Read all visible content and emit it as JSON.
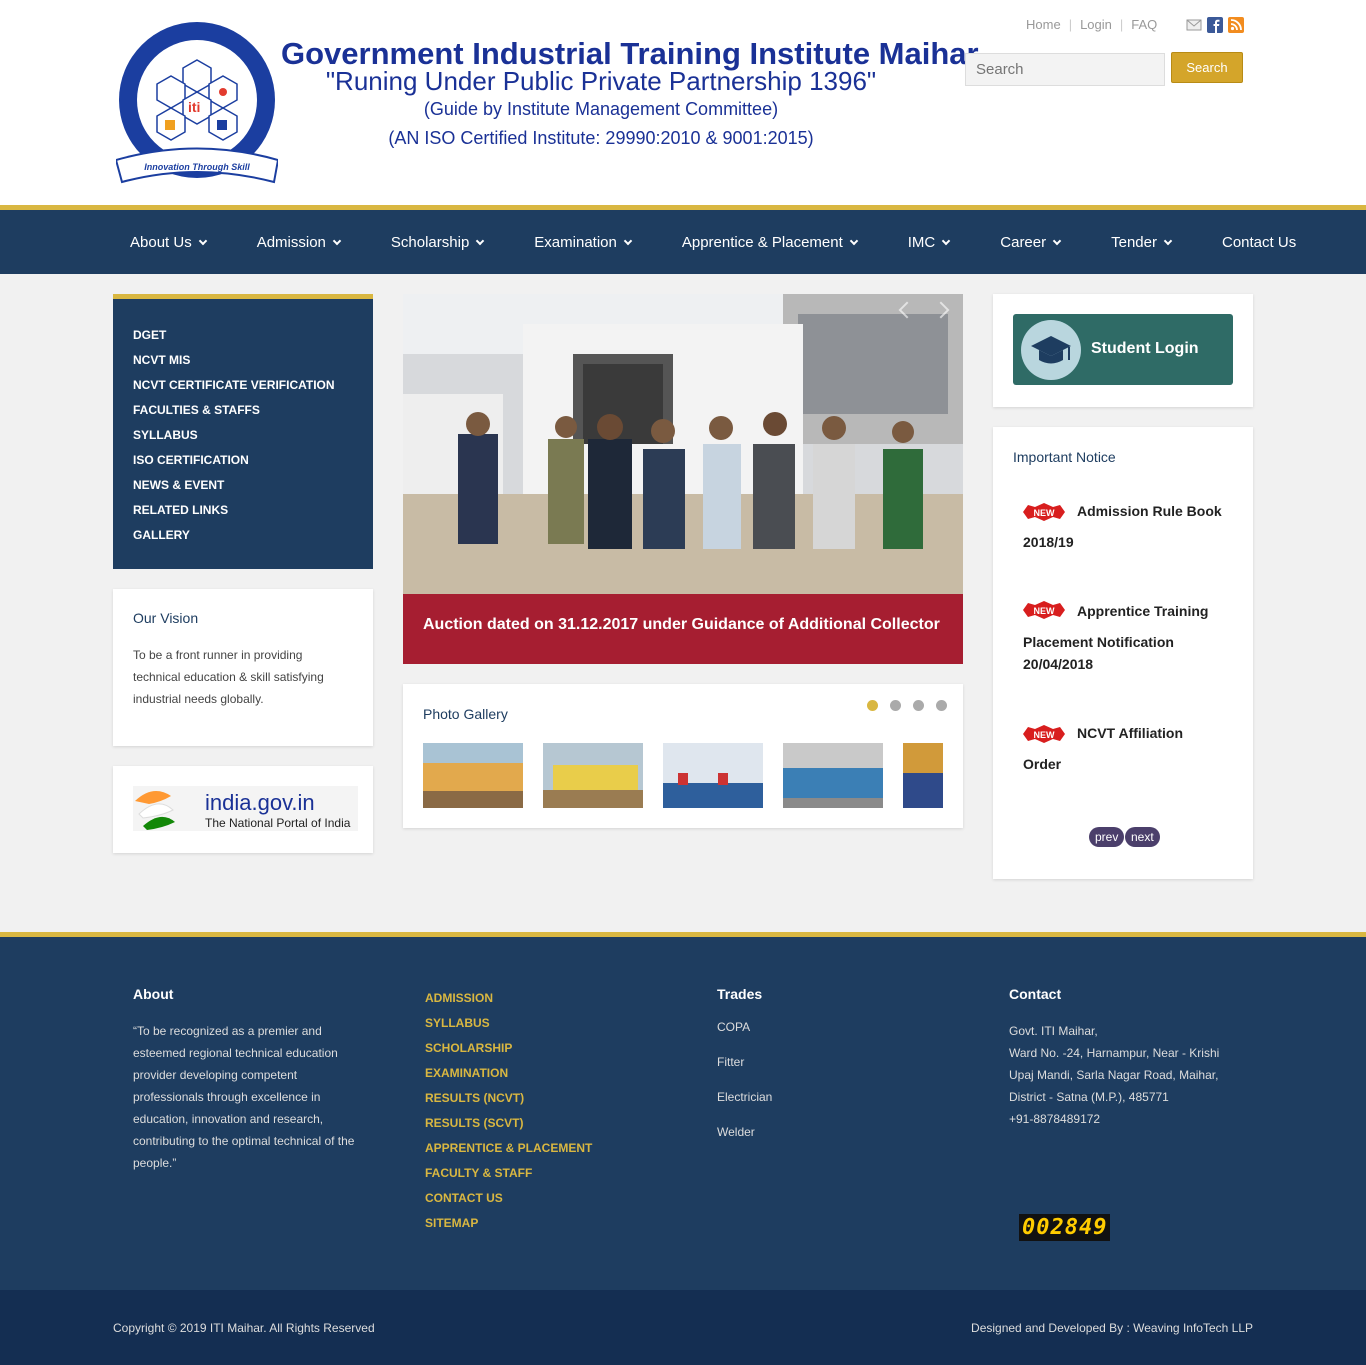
{
  "header": {
    "logo_text_top": "Govt. Industrial Training Institute Maihar",
    "logo_text_center": "iti",
    "logo_ribbon": "Innovation Through Skill",
    "title": "Government Industrial Training Institute Maihar",
    "subtitle": "\"Runing Under Public Private Partnership 1396\"",
    "guide": "(Guide by Institute Management Committee)",
    "iso": "(AN ISO Certified Institute: 29990:2010 & 9001:2015)",
    "top_links": [
      "Home",
      "Login",
      "FAQ"
    ],
    "search_placeholder": "Search",
    "search_button": "Search"
  },
  "nav": [
    {
      "label": "About Us",
      "dropdown": true
    },
    {
      "label": "Admission",
      "dropdown": true
    },
    {
      "label": "Scholarship",
      "dropdown": true
    },
    {
      "label": "Examination",
      "dropdown": true
    },
    {
      "label": "Apprentice & Placement",
      "dropdown": true
    },
    {
      "label": "IMC",
      "dropdown": true
    },
    {
      "label": "Career",
      "dropdown": true
    },
    {
      "label": "Tender",
      "dropdown": true
    },
    {
      "label": "Contact Us",
      "dropdown": false
    }
  ],
  "side_menu": [
    "DGET",
    "NCVT MIS",
    "NCVT CERTIFICATE VERIFICATION",
    "FACULTIES & STAFFS",
    "SYLLABUS",
    "ISO CERTIFICATION",
    "NEWS & EVENT",
    "RELATED LINKS",
    "GALLERY"
  ],
  "vision": {
    "title": "Our Vision",
    "text": "To be a front runner in providing technical education & skill satisfying industrial needs globally."
  },
  "india_gov": {
    "name": "india.gov.in",
    "tagline": "The National Portal of India"
  },
  "slider": {
    "caption": "Auction dated on 31.12.2017 under Guidance of Additional Collector"
  },
  "gallery": {
    "title": "Photo Gallery",
    "active_dot": 1,
    "dots": 4
  },
  "student_login": {
    "label": "Student Login"
  },
  "notice": {
    "title": "Important Notice",
    "badge": "NEW",
    "items": [
      {
        "line1": "Admission Rule Book",
        "line2": "2018/19"
      },
      {
        "line1": "Apprentice Training",
        "line2": "Placement Notification 20/04/2018"
      },
      {
        "line1": "NCVT Affiliation",
        "line2": "Order"
      }
    ],
    "prev": "prev",
    "next": "next"
  },
  "footer": {
    "about_title": "About",
    "about_text": "“To be recognized as a premier and esteemed regional technical education provider developing competent professionals through excellence in education, innovation and research, contributing to the optimal technical of the people.”",
    "links": [
      "ADMISSION",
      "SYLLABUS",
      "SCHOLARSHIP",
      "EXAMINATION",
      "RESULTS (NCVT)",
      "RESULTS (SCVT)",
      "APPRENTICE & PLACEMENT",
      "FACULTY & STAFF",
      "CONTACT US",
      "SITEMAP"
    ],
    "trades_title": "Trades",
    "trades": [
      "COPA",
      "Fitter",
      "Electrician",
      "Welder"
    ],
    "contact_title": "Contact",
    "contact_lines": [
      "Govt. ITI Maihar,",
      "Ward No. -24, Harnampur, Near - Krishi Upaj Mandi, Sarla Nagar Road, Maihar, District - Satna (M.P.), 485771",
      "+91-8878489172"
    ],
    "counter": "002849"
  },
  "bottom": {
    "copyright": "Copyright © 2019 ITI Maihar. All Rights Reserved",
    "designed": "Designed and Developed By : Weaving InfoTech LLP"
  },
  "colors": {
    "navy": "#1e3d60",
    "gold": "#d9b741",
    "caption_red": "#a61e31",
    "title_blue": "#1a3196",
    "student_teal": "#2f6b66"
  }
}
